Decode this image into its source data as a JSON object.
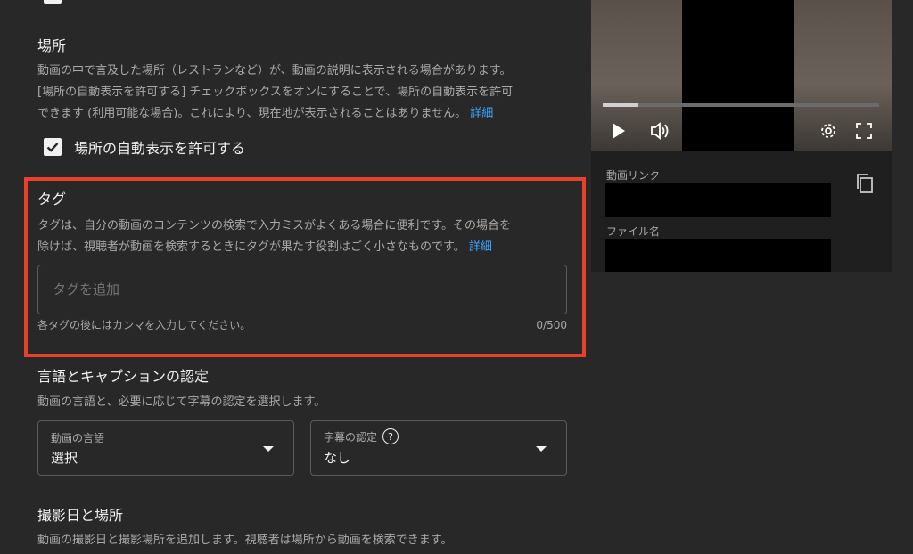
{
  "location": {
    "title": "場所",
    "desc_line1": "動画の中で言及した場所（レストランなど）が、動画の説明に表示される場合があります。",
    "desc_line2": "[場所の自動表示を許可する] チェックボックスをオンにすることで、場所の自動表示を許可",
    "desc_line3": "できます (利用可能な場合)。これにより、現在地が表示されることはありません。",
    "link": "詳細",
    "checkbox_label": "場所の自動表示を許可する",
    "checked": true
  },
  "tags": {
    "title": "タグ",
    "desc_line1": "タグは、自分の動画のコンテンツの検索で入力ミスがよくある場合に便利です。その場合を",
    "desc_line2": "除けば、視聴者が動画を検索するときにタグが果たす役割はごく小さなものです。",
    "link": "詳細",
    "placeholder": "タグを追加",
    "help": "各タグの後にはカンマを入力してください。",
    "counter": "0/500",
    "highlight_color": "#e8402a"
  },
  "language": {
    "title": "言語とキャプションの認定",
    "desc": "動画の言語と、必要に応じて字幕の認定を選択します。",
    "video_language_label": "動画の言語",
    "video_language_value": "選択",
    "caption_cert_label": "字幕の認定",
    "caption_cert_value": "なし"
  },
  "recording": {
    "title": "撮影日と場所",
    "desc": "動画の撮影日と撮影場所を追加します。視聴者は場所から動画を検索できます。"
  },
  "side_panel": {
    "video_link_label": "動画リンク",
    "file_name_label": "ファイル名",
    "progress": 0.13
  }
}
